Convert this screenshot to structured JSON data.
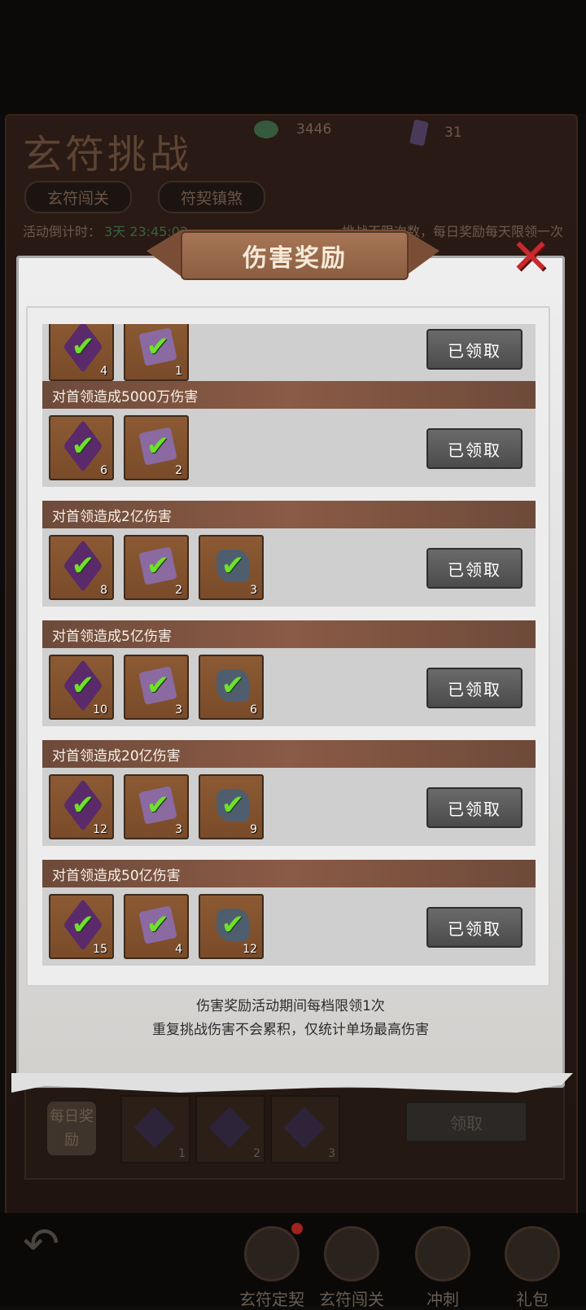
{
  "background": {
    "title": "玄符挑战",
    "resources": [
      {
        "icon": "jade-coin-icon",
        "value": "3446"
      },
      {
        "icon": "talisman-scroll-icon",
        "value": "31"
      }
    ],
    "tabs": [
      "玄符闯关",
      "符契镇煞"
    ],
    "countdown_label": "活动倒计时：",
    "countdown_value": "3天 23:45:02",
    "limit_text": "挑战不限次数，每日奖励每天限领一次",
    "daily": {
      "label": "每日奖励",
      "items": [
        {
          "icon": "scroll-icon",
          "count": "1"
        },
        {
          "icon": "gem-icon",
          "count": "2"
        },
        {
          "icon": "stone-icon",
          "count": "3"
        }
      ],
      "claim_label": "领取"
    },
    "nav": [
      "玄符定契",
      "玄符闯关",
      "冲刺",
      "礼包"
    ]
  },
  "modal": {
    "title": "伤害奖励",
    "close_icon": "close-x-icon",
    "rows": [
      {
        "title": "",
        "items": [
          {
            "type": "gem",
            "count": "4"
          },
          {
            "type": "scroll",
            "count": "1"
          }
        ],
        "button": "已领取"
      },
      {
        "title": "对首领造成5000万伤害",
        "items": [
          {
            "type": "gem",
            "count": "6"
          },
          {
            "type": "scroll",
            "count": "2"
          }
        ],
        "button": "已领取"
      },
      {
        "title": "对首领造成2亿伤害",
        "items": [
          {
            "type": "gem",
            "count": "8"
          },
          {
            "type": "scroll",
            "count": "2"
          },
          {
            "type": "stone",
            "count": "3"
          }
        ],
        "button": "已领取"
      },
      {
        "title": "对首领造成5亿伤害",
        "items": [
          {
            "type": "gem",
            "count": "10"
          },
          {
            "type": "scroll",
            "count": "3"
          },
          {
            "type": "stone",
            "count": "6"
          }
        ],
        "button": "已领取"
      },
      {
        "title": "对首领造成20亿伤害",
        "items": [
          {
            "type": "gem",
            "count": "12"
          },
          {
            "type": "scroll",
            "count": "3"
          },
          {
            "type": "stone",
            "count": "9"
          }
        ],
        "button": "已领取"
      },
      {
        "title": "对首领造成50亿伤害",
        "items": [
          {
            "type": "gem",
            "count": "15"
          },
          {
            "type": "scroll",
            "count": "4"
          },
          {
            "type": "stone",
            "count": "12"
          }
        ],
        "button": "已领取"
      }
    ],
    "notes": [
      "伤害奖励活动期间每档限领1次",
      "重复挑战伤害不会累积，仅统计单场最高伤害"
    ]
  }
}
